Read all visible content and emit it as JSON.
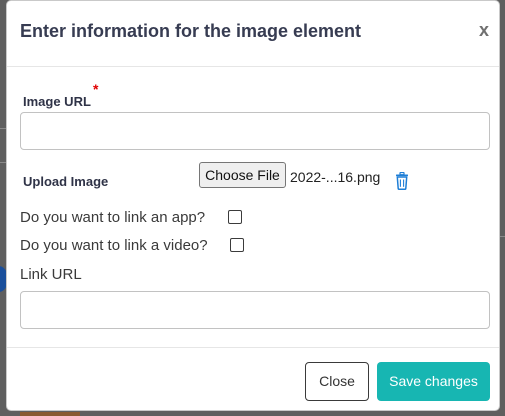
{
  "modal": {
    "title": "Enter information for the image element",
    "close_symbol": "x"
  },
  "form": {
    "image_url": {
      "label": "Image URL",
      "required_marker": "*",
      "value": "",
      "placeholder": ""
    },
    "upload_image": {
      "label": "Upload Image",
      "button_label": "Choose File",
      "file_name": "2022-...16.png",
      "remove_icon": "trash-icon"
    },
    "link_app": {
      "label": "Do you want to link an app?",
      "checked": false
    },
    "link_video": {
      "label": "Do you want to link a video?",
      "checked": false
    },
    "link_url": {
      "label": "Link URL",
      "value": "",
      "placeholder": ""
    }
  },
  "footer": {
    "close_label": "Close",
    "save_label": "Save changes"
  },
  "colors": {
    "accent": "#17b6b2",
    "required": "#e00000",
    "title_text": "#373c52",
    "icon_blue": "#1e7ed6"
  }
}
